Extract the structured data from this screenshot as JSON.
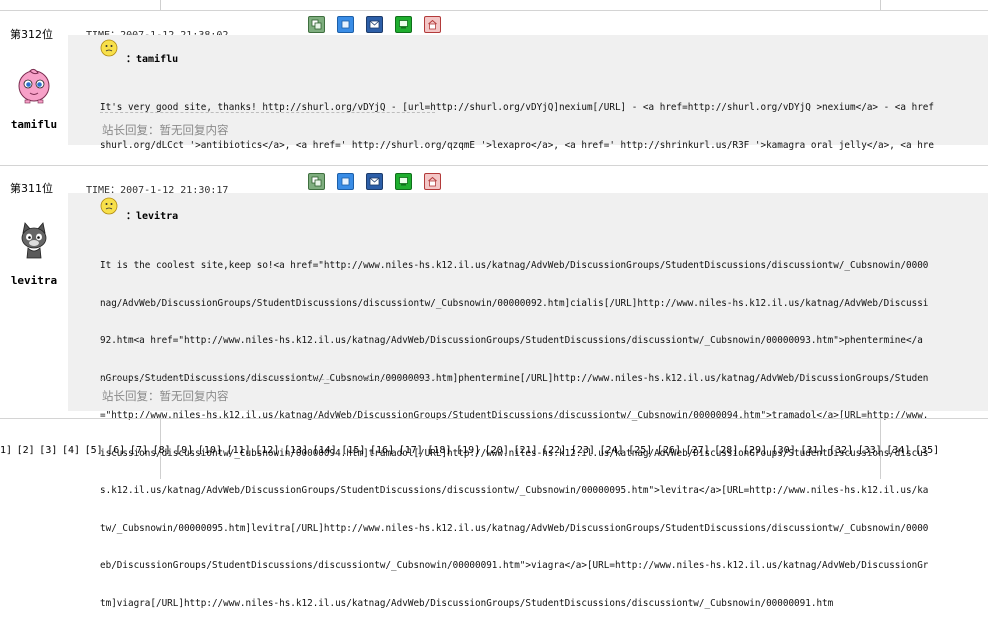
{
  "posts": [
    {
      "number": "第312位",
      "author": "tamiflu",
      "time": "TIME：2007-1-12 21:38:02",
      "title": "：tamiflu",
      "body_lines": [
        "It's very good site, thanks! http://shurl.org/vDYjQ - [url=http://shurl.org/vDYjQ]nexium[/URL] - <a href=http://shurl.org/vDYjQ >nexium</a> - <a href",
        "shurl.org/dLCct '>antibiotics</a>, <a href=' http://shurl.org/qzqmE '>lexapro</a>, <a href=' http://shrinkurl.us/R3F '>kamagra oral jelly</a>, <a hre"
      ],
      "reply": "站长回复：暂无回复内容",
      "avatar_icon": "jigglypuff-avatar-icon"
    },
    {
      "number": "第311位",
      "author": "levitra",
      "time": "TIME：2007-1-12 21:30:17",
      "title": "：levitra",
      "body_lines": [
        "It is the coolest site,keep so!<a href=\"http://www.niles-hs.k12.il.us/katnag/AdvWeb/DiscussionGroups/StudentDiscussions/discussiontw/_Cubsnowin/0000",
        "nag/AdvWeb/DiscussionGroups/StudentDiscussions/discussiontw/_Cubsnowin/00000092.htm]cialis[/URL]http://www.niles-hs.k12.il.us/katnag/AdvWeb/Discussi",
        "92.htm<a href=\"http://www.niles-hs.k12.il.us/katnag/AdvWeb/DiscussionGroups/StudentDiscussions/discussiontw/_Cubsnowin/00000093.htm\">phentermine</a",
        "nGroups/StudentDiscussions/discussiontw/_Cubsnowin/00000093.htm]phentermine[/URL]http://www.niles-hs.k12.il.us/katnag/AdvWeb/DiscussionGroups/Studen",
        "=\"http://www.niles-hs.k12.il.us/katnag/AdvWeb/DiscussionGroups/StudentDiscussions/discussiontw/_Cubsnowin/00000094.htm\">tramadol</a>[URL=http://www.",
        "iscussions/discussiontw/_Cubsnowin/00000094.htm]tramadol[/URL]http://www.niles-hs.k12.il.us/katnag/AdvWeb/DiscussionGroups/StudentDiscussions/discus",
        "s.k12.il.us/katnag/AdvWeb/DiscussionGroups/StudentDiscussions/discussiontw/_Cubsnowin/00000095.htm\">levitra</a>[URL=http://www.niles-hs.k12.il.us/ka",
        "tw/_Cubsnowin/00000095.htm]levitra[/URL]http://www.niles-hs.k12.il.us/katnag/AdvWeb/DiscussionGroups/StudentDiscussions/discussiontw/_Cubsnowin/0000",
        "eb/DiscussionGroups/StudentDiscussions/discussiontw/_Cubsnowin/00000091.htm\">viagra</a>[URL=http://www.niles-hs.k12.il.us/katnag/AdvWeb/DiscussionGr",
        "tm]viagra[/URL]http://www.niles-hs.k12.il.us/katnag/AdvWeb/DiscussionGroups/StudentDiscussions/discussiontw/_Cubsnowin/00000091.htm"
      ],
      "reply": "站长回复：暂无回复内容",
      "avatar_icon": "cat-avatar-icon"
    }
  ],
  "action_icons": [
    "copy-icon",
    "home-icon",
    "mail-icon",
    "comment-icon",
    "delete-icon"
  ],
  "pager": [
    "1]",
    "[2]",
    "[3]",
    "[4]",
    "[5]",
    "[6]",
    "[7]",
    "[8]",
    "[9]",
    "[10]",
    "[11]",
    "[12]",
    "[13]",
    "[14]",
    "[15]",
    "[16]",
    "[17]",
    "[18]",
    "[19]",
    "[20]",
    "[21]",
    "[22]",
    "[23]",
    "[24]",
    "[25]",
    "[26]",
    "[27]",
    "[28]",
    "[29]",
    "[30]",
    "[31]",
    "[32]",
    "[33]",
    "[34]",
    "[35]"
  ],
  "colors": {
    "box_bg": "#f0f0f0",
    "reply_text": "#8a8a8a",
    "border": "#d4d4d4"
  }
}
